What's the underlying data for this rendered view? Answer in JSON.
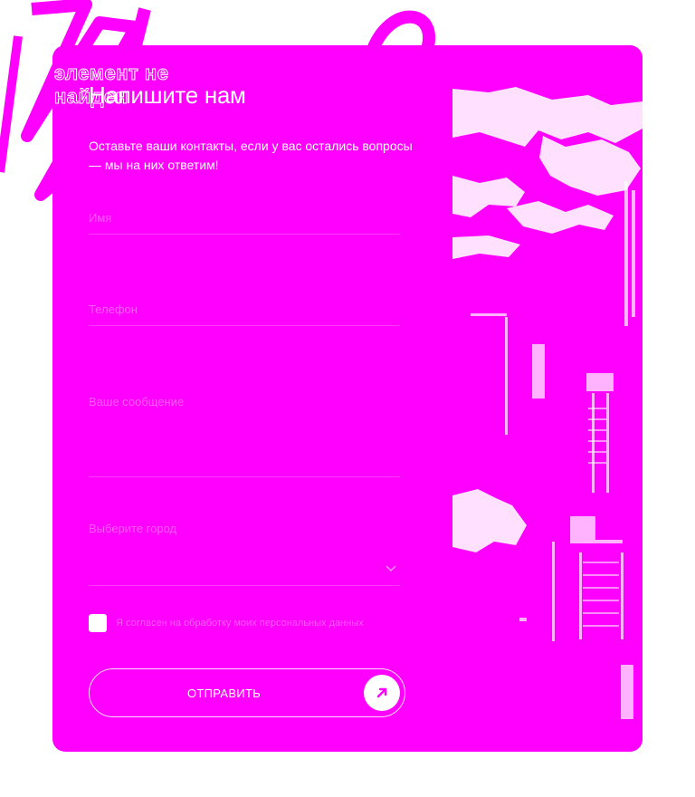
{
  "error_text": "элемент не найден",
  "form": {
    "title": "Напишите нам",
    "subtitle": "Оставьте ваши контакты, если у вас остались вопросы — мы на них ответим!",
    "fields": {
      "name_placeholder": "Имя",
      "phone_placeholder": "Телефон",
      "message_placeholder": "Ваше сообщение",
      "select_label": "Выберите город"
    },
    "consent_label": "Я согласен на обработку моих персональных данных",
    "submit_label": "ОТПРАВИТЬ"
  },
  "icons": {
    "select": "chevron-down-icon",
    "submit": "arrow-up-right-icon"
  },
  "colors": {
    "accent": "#ff00ff",
    "text": "#ffffff",
    "arrow": "#ff00ff"
  }
}
